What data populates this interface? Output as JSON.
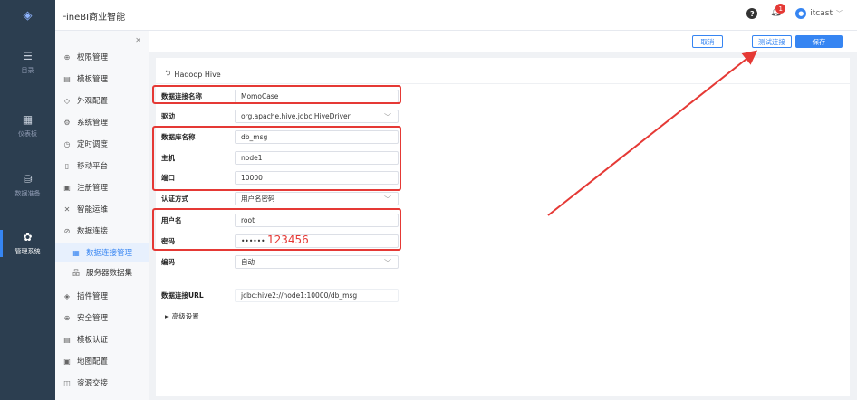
{
  "app": {
    "title": "FineBI商业智能"
  },
  "header": {
    "help_icon": "?",
    "notification_count": "1",
    "user": "itcast"
  },
  "leftnav": {
    "items": [
      {
        "icon": "list-icon",
        "glyph": "☰",
        "label": "目录"
      },
      {
        "icon": "dashboard-icon",
        "glyph": "▦",
        "label": "仪表板"
      },
      {
        "icon": "database-icon",
        "glyph": "⛁",
        "label": "数据准备"
      },
      {
        "icon": "gear-icon",
        "glyph": "✿",
        "label": "管理系统"
      }
    ]
  },
  "submenu": {
    "items": [
      {
        "label": "权限管理",
        "glyph": "⊕"
      },
      {
        "label": "模板管理",
        "glyph": "▤"
      },
      {
        "label": "外观配置",
        "glyph": "◇"
      },
      {
        "label": "系统管理",
        "glyph": "⚙"
      },
      {
        "label": "定时调度",
        "glyph": "◷"
      },
      {
        "label": "移动平台",
        "glyph": "▯"
      },
      {
        "label": "注册管理",
        "glyph": "▣"
      },
      {
        "label": "智能运维",
        "glyph": "✕"
      },
      {
        "label": "数据连接",
        "glyph": "⊘"
      },
      {
        "label": "数据连接管理",
        "glyph": "▦"
      },
      {
        "label": "服务器数据集",
        "glyph": "品"
      },
      {
        "label": "插件管理",
        "glyph": "◈"
      },
      {
        "label": "安全管理",
        "glyph": "⊕"
      },
      {
        "label": "模板认证",
        "glyph": "▤"
      },
      {
        "label": "地图配置",
        "glyph": "▣"
      },
      {
        "label": "资源交接",
        "glyph": "◫"
      }
    ]
  },
  "toolbar": {
    "cancel": "取消",
    "test": "测试连接",
    "save": "保存"
  },
  "form": {
    "back": "Hadoop Hive",
    "fields": [
      {
        "label": "数据连接名称",
        "value": "MomoCase",
        "kind": "text"
      },
      {
        "label": "驱动",
        "value": "org.apache.hive.jdbc.HiveDriver",
        "kind": "select"
      },
      {
        "label": "数据库名称",
        "value": "db_msg",
        "kind": "text"
      },
      {
        "label": "主机",
        "value": "node1",
        "kind": "text"
      },
      {
        "label": "端口",
        "value": "10000",
        "kind": "text"
      },
      {
        "label": "认证方式",
        "value": "用户名密码",
        "kind": "select"
      },
      {
        "label": "用户名",
        "value": "root",
        "kind": "text"
      },
      {
        "label": "密码",
        "value": "••••••",
        "kind": "password"
      },
      {
        "label": "编码",
        "value": "自动",
        "kind": "select"
      },
      {
        "label": "数据连接URL",
        "value": "jdbc:hive2://node1:10000/db_msg",
        "kind": "plain"
      }
    ],
    "password_annotation": "123456",
    "advanced": "高级设置"
  },
  "colors": {
    "accent": "#3685f2",
    "nav_bg": "#2c3e50",
    "annotation": "#e53935"
  }
}
